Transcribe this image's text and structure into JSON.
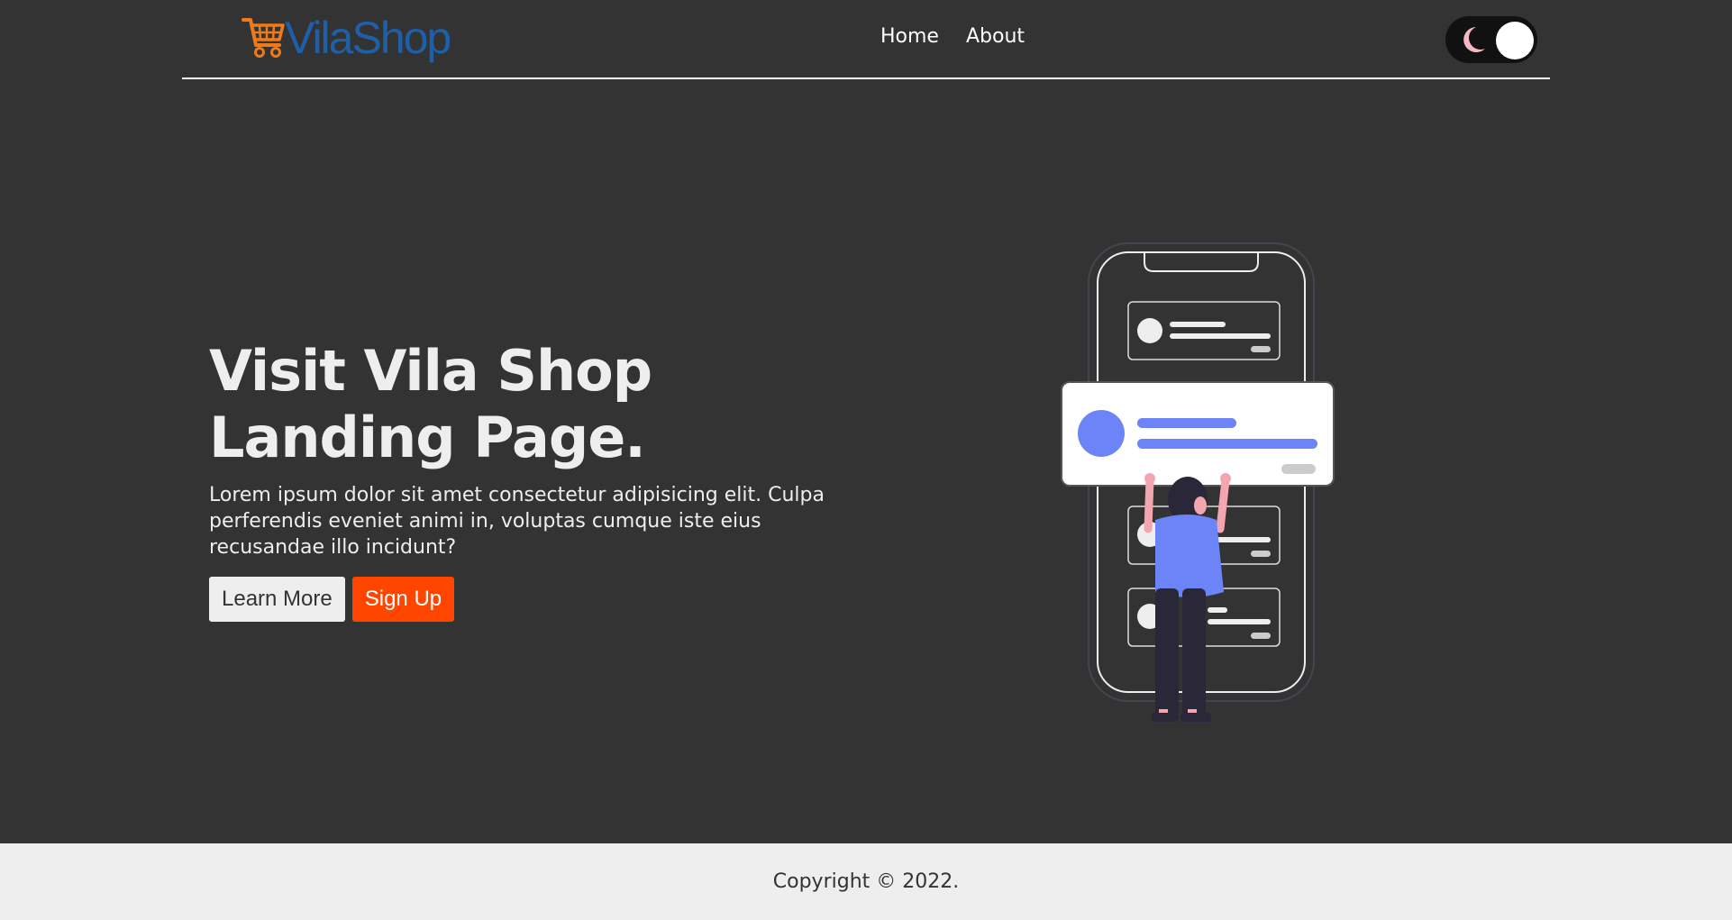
{
  "header": {
    "logo_text": "VilaShop",
    "logo_icon": "shopping-cart-icon",
    "nav": [
      {
        "label": "Home"
      },
      {
        "label": "About"
      }
    ],
    "theme_toggle": {
      "icon": "moon-icon",
      "state": "dark"
    }
  },
  "hero": {
    "title": "Visit Vila Shop Landing Page.",
    "description": "Lorem ipsum dolor sit amet consectetur adipisicing elit. Culpa perferendis eveniet animi in, voluptas cumque iste eius recusandae illo incidunt?",
    "learn_more_label": "Learn More",
    "sign_up_label": "Sign Up"
  },
  "footer": {
    "copyright": "Copyright © 2022."
  },
  "colors": {
    "background": "#333333",
    "accent": "#ff4500",
    "logo_blue": "#1e5fa8",
    "logo_orange": "#f07a1a",
    "illustration_blue": "#6c84f7",
    "footer_bg": "#eeeeee"
  }
}
